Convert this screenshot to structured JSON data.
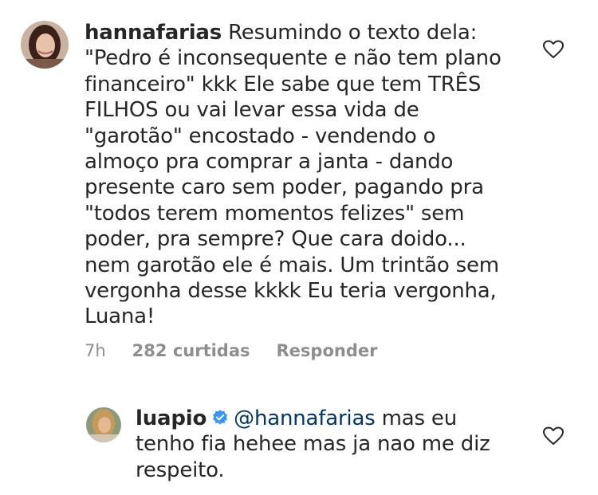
{
  "comments": [
    {
      "username": "hannafarias",
      "text_lines": [
        "Resumindo o texto dela:",
        "\"Pedro é inconsequente e não tem plano",
        "financeiro\" kkk Ele sabe que tem TRÊS",
        "FILHOS ou vai levar essa vida de",
        "\"garotão\" encostado - vendendo o",
        "almoço pra comprar a janta - dando",
        "presente caro sem poder, pagando pra",
        "\"todos terem momentos felizes\" sem",
        "poder, pra sempre? Que cara doido...",
        "nem garotão ele é mais. Um trintão sem",
        "vergonha desse kkkk Eu teria vergonha,",
        "Luana!"
      ],
      "time": "7h",
      "likes": "282 curtidas",
      "reply_label": "Responder"
    },
    {
      "username": "luapio",
      "verified": true,
      "mention": "@hannafarias",
      "text_lines": [
        "mas eu",
        "tenho fia hehee mas ja nao me diz",
        "respeito."
      ]
    }
  ],
  "icons": {
    "like": "heart-outline-icon",
    "verified": "verified-badge-icon"
  },
  "colors": {
    "text": "#262626",
    "meta": "#8e8e8e",
    "mention": "#003569",
    "verified": "#3897f0"
  }
}
